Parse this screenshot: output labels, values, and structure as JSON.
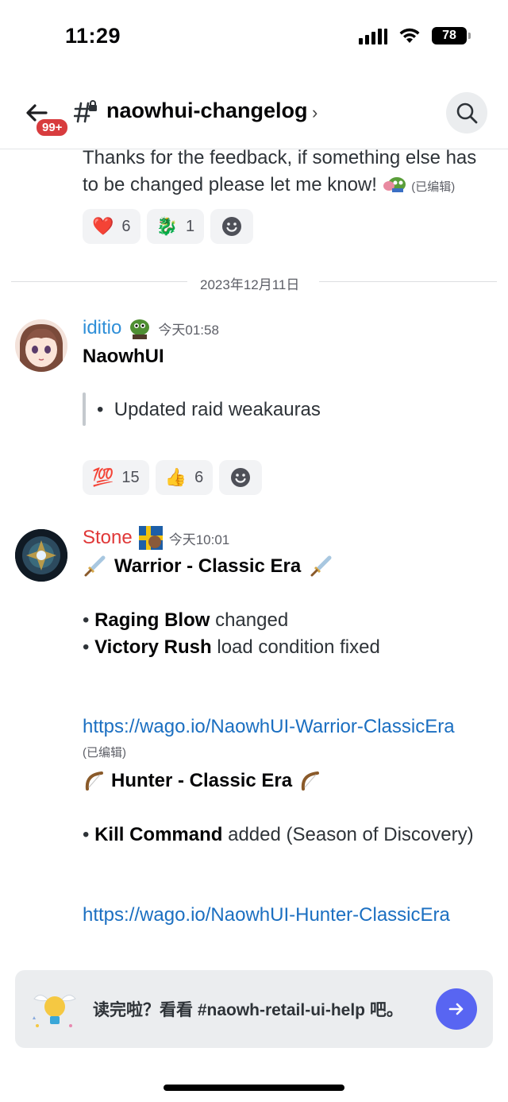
{
  "status_bar": {
    "time": "11:29",
    "battery": "78"
  },
  "header": {
    "badge": "99+",
    "channel_name": "naowhui-changelog",
    "chevron": "›"
  },
  "messages": {
    "prev": {
      "text": "Thanks for the feedback, if something else has to be changed please let me know!",
      "edited": "(已编辑)",
      "reactions": [
        {
          "emoji": "❤️",
          "count": "6"
        },
        {
          "emoji": "🐉",
          "count": "1"
        }
      ]
    },
    "date_divider": "2023年12月11日",
    "iditio": {
      "username": "iditio",
      "username_color": "#2f8fd8",
      "timestamp": "今天01:58",
      "title": "NaowhUI",
      "bullet": "Updated raid weakauras",
      "reactions": [
        {
          "emoji": "💯",
          "count": "15"
        },
        {
          "emoji": "👍",
          "count": "6"
        }
      ]
    },
    "stone": {
      "username": "Stone",
      "username_color": "#e03838",
      "timestamp": "今天10:01",
      "warrior_title": "Warrior - Classic Era",
      "line1_bold": "Raging Blow",
      "line1_rest": " changed",
      "line2_bold": "Victory Rush",
      "line2_rest": " load condition fixed",
      "link1": "https://wago.io/NaowhUI-Warrior-ClassicEra",
      "edited": "(已编辑)",
      "hunter_title": "Hunter - Classic Era",
      "line3_bold": "Kill Command",
      "line3_rest": " added (Season of Discovery)",
      "link2": "https://wago.io/NaowhUI-Hunter-ClassicEra"
    }
  },
  "composer": {
    "text": "读完啦？看看 #naowh-retail-ui-help 吧。"
  }
}
